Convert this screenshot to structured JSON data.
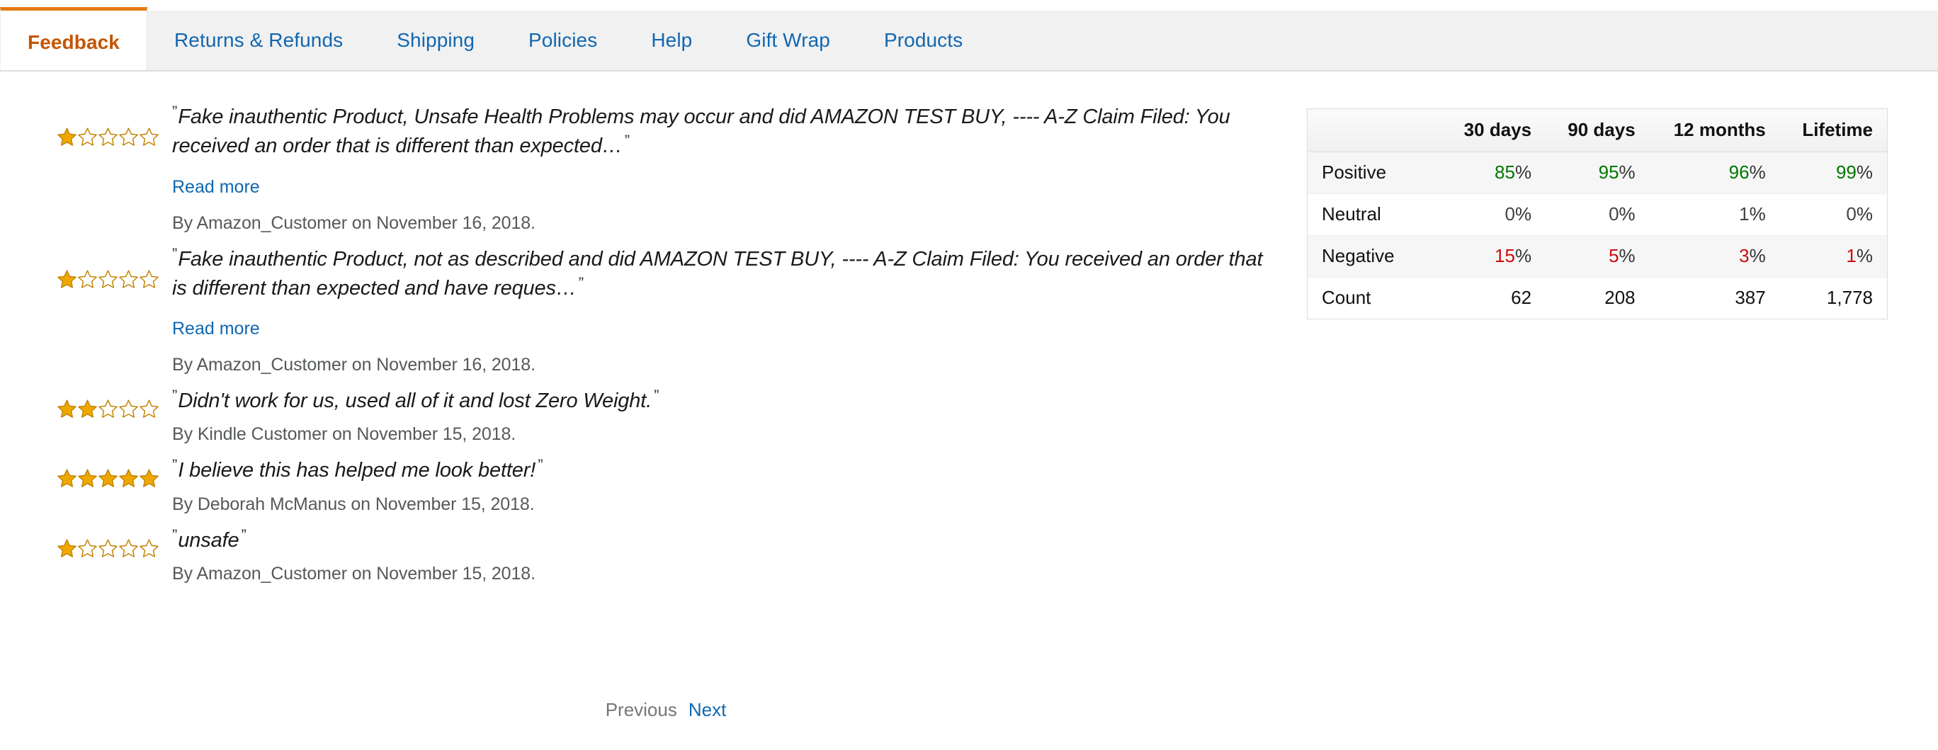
{
  "tabs": [
    {
      "label": "Feedback",
      "active": true
    },
    {
      "label": "Returns & Refunds",
      "active": false
    },
    {
      "label": "Shipping",
      "active": false
    },
    {
      "label": "Policies",
      "active": false
    },
    {
      "label": "Help",
      "active": false
    },
    {
      "label": "Gift Wrap",
      "active": false
    },
    {
      "label": "Products",
      "active": false
    }
  ],
  "colors": {
    "active_tab_text": "#c45500",
    "active_tab_border": "#e47911",
    "link": "#1167b1",
    "tabbar_bg": "#f1f1f1",
    "star_fill": "#f0a800",
    "star_outline": "#c08300",
    "positive": "#007600",
    "negative": "#cc0c0c",
    "neutral": "#444444",
    "byline": "#565959"
  },
  "reviews": [
    {
      "rating": 1,
      "max_rating": 5,
      "quote": "Fake inauthentic Product, Unsafe Health Problems may occur and did AMAZON TEST BUY, ---- A-Z Claim Filed: You received an order that is different than expected…",
      "read_more_label": "Read more",
      "has_read_more": true,
      "byline": "By Amazon_Customer on November 16, 2018."
    },
    {
      "rating": 1,
      "max_rating": 5,
      "quote": "Fake inauthentic Product, not as described and did AMAZON TEST BUY, ---- A-Z Claim Filed: You received an order that is different than expected and have reques…",
      "read_more_label": "Read more",
      "has_read_more": true,
      "byline": "By Amazon_Customer on November 16, 2018."
    },
    {
      "rating": 2,
      "max_rating": 5,
      "quote": "Didn't work for us, used all of it and lost Zero Weight.",
      "read_more_label": "",
      "has_read_more": false,
      "byline": "By Kindle Customer on November 15, 2018."
    },
    {
      "rating": 5,
      "max_rating": 5,
      "quote": "I believe this has helped me look better!",
      "read_more_label": "",
      "has_read_more": false,
      "byline": "By Deborah McManus on November 15, 2018."
    },
    {
      "rating": 1,
      "max_rating": 5,
      "quote": "unsafe",
      "read_more_label": "",
      "has_read_more": false,
      "byline": "By Amazon_Customer on November 15, 2018."
    }
  ],
  "stats_table": {
    "corner_label": "",
    "columns": [
      "30 days",
      "90 days",
      "12 months",
      "Lifetime"
    ],
    "rows": [
      {
        "label": "Positive",
        "style": "positive",
        "values": [
          "85%",
          "95%",
          "96%",
          "99%"
        ],
        "numbers": [
          "85",
          "95",
          "96",
          "99"
        ],
        "suffix": "%"
      },
      {
        "label": "Neutral",
        "style": "neutral",
        "values": [
          "0%",
          "0%",
          "1%",
          "0%"
        ],
        "numbers": [
          "0",
          "0",
          "1",
          "0"
        ],
        "suffix": "%"
      },
      {
        "label": "Negative",
        "style": "negative",
        "values": [
          "15%",
          "5%",
          "3%",
          "1%"
        ],
        "numbers": [
          "15",
          "5",
          "3",
          "1"
        ],
        "suffix": "%"
      },
      {
        "label": "Count",
        "style": "count",
        "values": [
          "62",
          "208",
          "387",
          "1,778"
        ],
        "numbers": [
          "62",
          "208",
          "387",
          "1,778"
        ],
        "suffix": ""
      }
    ]
  },
  "pagination": {
    "previous_label": "Previous",
    "next_label": "Next",
    "previous_enabled": false,
    "next_enabled": true
  }
}
